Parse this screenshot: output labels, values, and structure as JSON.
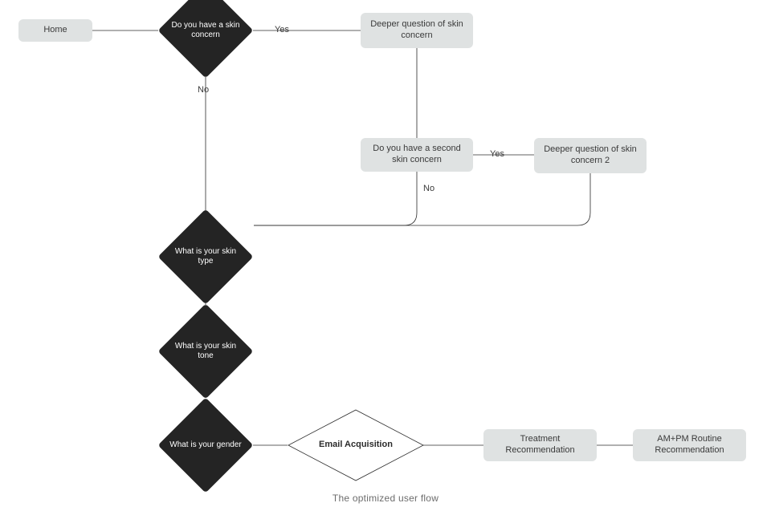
{
  "caption": "The optimized user flow",
  "nodes": {
    "home": "Home",
    "q_concern": "Do you have a skin concern",
    "deeper1": "Deeper question of skin concern",
    "q_second_concern": "Do you have a second skin concern",
    "deeper2": "Deeper question of skin concern 2",
    "q_skin_type": "What is your skin type",
    "q_skin_tone": "What is your skin tone",
    "q_gender": "What is your gender",
    "email": "Email Acquisition",
    "treatment": "Treatment Recommendation",
    "routine": "AM+PM Routine Recommendation"
  },
  "labels": {
    "yes": "Yes",
    "no": "No"
  },
  "chart_data": {
    "type": "flowchart",
    "title": "The optimized user flow",
    "nodes": [
      {
        "id": "home",
        "kind": "terminator",
        "text": "Home"
      },
      {
        "id": "q_concern",
        "kind": "decision",
        "text": "Do you have a skin concern"
      },
      {
        "id": "deeper1",
        "kind": "process",
        "text": "Deeper question of skin concern"
      },
      {
        "id": "q_second_concern",
        "kind": "process",
        "text": "Do you have a second skin concern"
      },
      {
        "id": "deeper2",
        "kind": "process",
        "text": "Deeper question of skin concern 2"
      },
      {
        "id": "q_skin_type",
        "kind": "decision",
        "text": "What is your skin type"
      },
      {
        "id": "q_skin_tone",
        "kind": "decision",
        "text": "What is your skin tone"
      },
      {
        "id": "q_gender",
        "kind": "decision",
        "text": "What is your gender"
      },
      {
        "id": "email",
        "kind": "decision_light",
        "text": "Email Acquisition"
      },
      {
        "id": "treatment",
        "kind": "process",
        "text": "Treatment Recommendation"
      },
      {
        "id": "routine",
        "kind": "process",
        "text": "AM+PM Routine Recommendation"
      }
    ],
    "edges": [
      {
        "from": "home",
        "to": "q_concern"
      },
      {
        "from": "q_concern",
        "to": "deeper1",
        "label": "Yes"
      },
      {
        "from": "q_concern",
        "to": "q_skin_type",
        "label": "No"
      },
      {
        "from": "deeper1",
        "to": "q_second_concern"
      },
      {
        "from": "q_second_concern",
        "to": "deeper2",
        "label": "Yes"
      },
      {
        "from": "q_second_concern",
        "to": "q_skin_type",
        "label": "No"
      },
      {
        "from": "deeper2",
        "to": "q_skin_type"
      },
      {
        "from": "q_skin_type",
        "to": "q_skin_tone"
      },
      {
        "from": "q_skin_tone",
        "to": "q_gender"
      },
      {
        "from": "q_gender",
        "to": "email"
      },
      {
        "from": "email",
        "to": "treatment"
      },
      {
        "from": "treatment",
        "to": "routine"
      }
    ]
  }
}
